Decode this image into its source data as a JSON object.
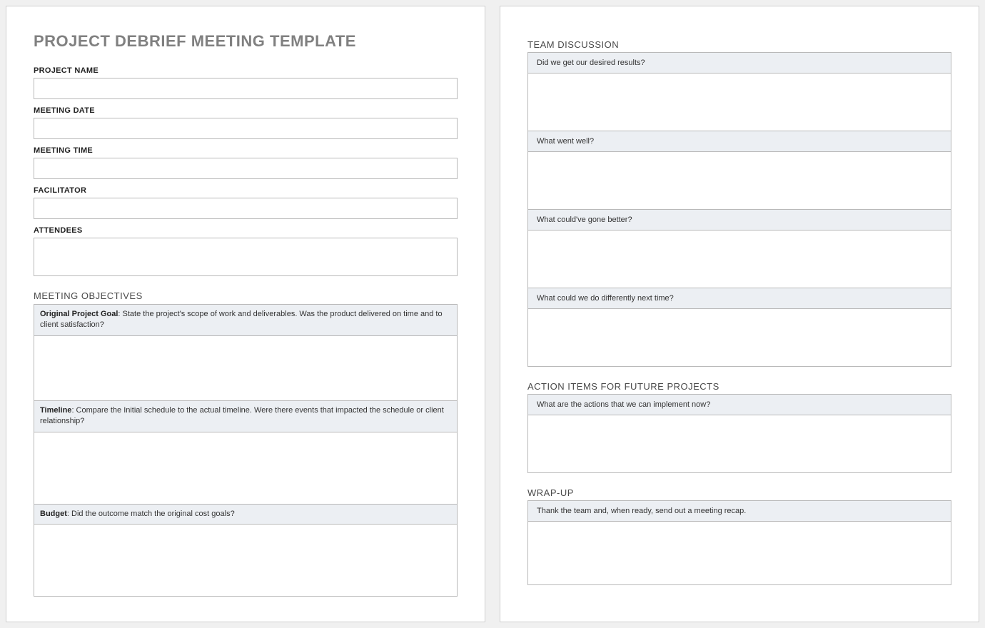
{
  "doc": {
    "title": "PROJECT DEBRIEF MEETING TEMPLATE"
  },
  "fields": {
    "project_name": {
      "label": "PROJECT NAME",
      "value": ""
    },
    "meeting_date": {
      "label": "MEETING DATE",
      "value": ""
    },
    "meeting_time": {
      "label": "MEETING TIME",
      "value": ""
    },
    "facilitator": {
      "label": "FACILITATOR",
      "value": ""
    },
    "attendees": {
      "label": "ATTENDEES",
      "value": ""
    }
  },
  "sections": {
    "objectives": {
      "heading": "MEETING OBJECTIVES",
      "items": [
        {
          "bold": "Original Project Goal",
          "text": ": State the project's scope of work and deliverables. Was the product delivered on time and to client satisfaction?"
        },
        {
          "bold": "Timeline",
          "text": ": Compare the Initial schedule to the actual timeline. Were there events that impacted the schedule or client relationship?"
        },
        {
          "bold": "Budget",
          "text": ": Did the outcome match the original cost goals?"
        }
      ]
    },
    "discussion": {
      "heading": "TEAM DISCUSSION",
      "items": [
        {
          "text": "Did we get our desired results?"
        },
        {
          "text": "What went well?"
        },
        {
          "text": "What could've gone better?"
        },
        {
          "text": "What could we do differently next time?"
        }
      ]
    },
    "actions": {
      "heading": "ACTION ITEMS FOR FUTURE PROJECTS",
      "items": [
        {
          "text": "What are the actions that we can implement now?"
        }
      ]
    },
    "wrapup": {
      "heading": "WRAP-UP",
      "items": [
        {
          "text": "Thank the team and, when ready, send out a meeting recap."
        }
      ]
    }
  }
}
